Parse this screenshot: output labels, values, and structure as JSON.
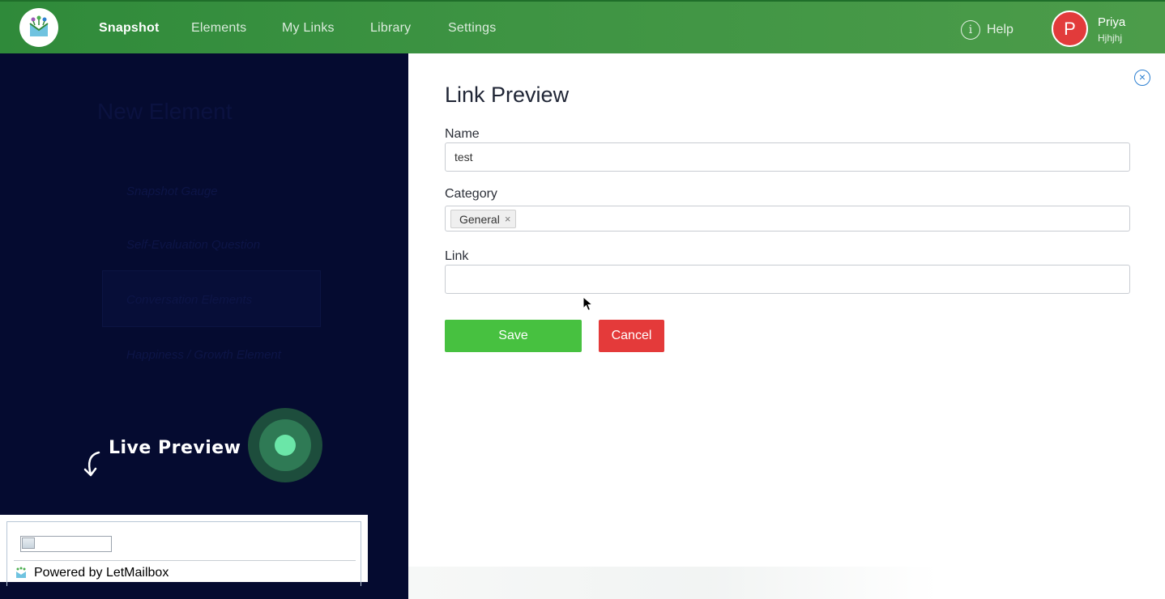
{
  "nav": {
    "items": [
      {
        "label": "Snapshot",
        "active": true
      },
      {
        "label": "Elements",
        "active": false
      },
      {
        "label": "My Links",
        "active": false
      },
      {
        "label": "Library",
        "active": false
      },
      {
        "label": "Settings",
        "active": false
      }
    ],
    "help_label": "Help",
    "user": {
      "initial": "P",
      "name": "Priya",
      "subtitle": "Hjhjhj"
    }
  },
  "background": {
    "title": "New Element",
    "items": [
      "Snapshot Gauge",
      "Self-Evaluation Question",
      "Conversation Elements",
      "Happiness / Growth Element"
    ]
  },
  "live_preview": {
    "label": "Live Preview"
  },
  "widget": {
    "powered_text": "Powered by LetMailbox"
  },
  "form": {
    "title": "Link Preview",
    "name": {
      "label": "Name",
      "value": "test"
    },
    "category": {
      "label": "Category",
      "tags": [
        "General"
      ]
    },
    "link": {
      "label": "Link",
      "value": ""
    },
    "save_label": "Save",
    "cancel_label": "Cancel",
    "close_icon": "×"
  },
  "colors": {
    "nav_green": "#3e9443",
    "save_green": "#47c140",
    "cancel_red": "#e43a3a",
    "avatar_red": "#e23b3b",
    "left_panel_bg": "#050b30",
    "close_blue": "#2b7fd1"
  }
}
